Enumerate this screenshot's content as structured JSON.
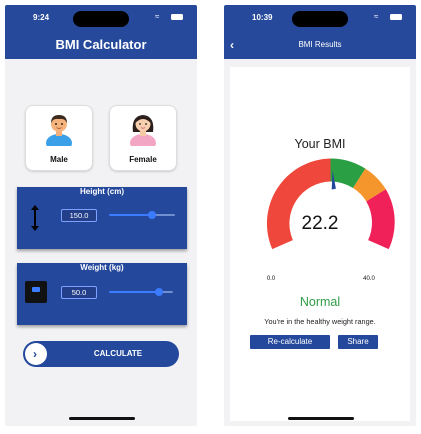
{
  "calculator": {
    "status": {
      "time": "9:24"
    },
    "title": "BMI Calculator",
    "gender": {
      "male": "Male",
      "female": "Female"
    },
    "height": {
      "title": "Height (cm)",
      "value": "150.0",
      "slider_fraction": 0.75
    },
    "weight": {
      "title": "Weight (kg)",
      "value": "50.0",
      "slider_fraction": 0.78
    },
    "calculate_label": "CALCULATE"
  },
  "results": {
    "status": {
      "time": "10:39"
    },
    "title": "BMI Results",
    "back_icon": "chevron-left-icon",
    "heading": "Your BMI",
    "bmi_value": "22.2",
    "gauge": {
      "min_label": "0.0",
      "max_label": "40.0",
      "min": 0,
      "max": 40,
      "value": 22.2,
      "colors": {
        "underweight": "#f0473c",
        "normal": "#2a9f44",
        "overweight": "#f5962c",
        "obese": "#ef2158",
        "needle": "#24489c"
      }
    },
    "category": "Normal",
    "description": "You're in the healthy weight range.",
    "recalculate_label": "Re-calculate",
    "share_label": "Share"
  },
  "colors": {
    "primary": "#24489c",
    "normal_green": "#2f9d46"
  }
}
